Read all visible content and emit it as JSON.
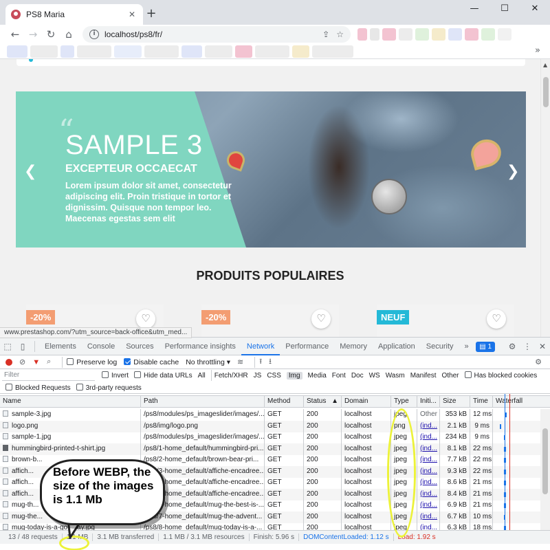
{
  "browser": {
    "tab_title": "PS8 Maria",
    "url": "localhost/ps8/fr/",
    "status_url": "www.prestashop.com/?utm_source=back-office&utm_med..."
  },
  "slider": {
    "title": "SAMPLE 3",
    "subtitle": "EXCEPTEUR OCCAECAT",
    "text": "Lorem ipsum dolor sit amet, consectetur adipiscing elit. Proin tristique in tortor et dignissim. Quisque non tempor leo. Maecenas egestas sem elit"
  },
  "section": {
    "title": "PRODUITS POPULAIRES"
  },
  "products": [
    {
      "badge": "-20%",
      "badge_type": "discount"
    },
    {
      "badge": "-20%",
      "badge_type": "discount"
    },
    {
      "badge": "NEUF",
      "badge_type": "new"
    }
  ],
  "devtools": {
    "tabs": [
      "Elements",
      "Console",
      "Sources",
      "Performance insights",
      "Network",
      "Performance",
      "Memory",
      "Application",
      "Security"
    ],
    "active_tab": "Network",
    "message_count": "1",
    "toolbar": {
      "preserve_log": "Preserve log",
      "disable_cache": "Disable cache",
      "throttling": "No throttling"
    },
    "filter": {
      "placeholder": "Filter",
      "invert": "Invert",
      "hide_data_urls": "Hide data URLs",
      "types": [
        "All",
        "Fetch/XHR",
        "JS",
        "CSS",
        "Img",
        "Media",
        "Font",
        "Doc",
        "WS",
        "Wasm",
        "Manifest",
        "Other"
      ],
      "active_type": "Img",
      "has_blocked_cookies": "Has blocked cookies",
      "blocked_requests": "Blocked Requests",
      "third_party": "3rd-party requests"
    },
    "columns": [
      "Name",
      "Path",
      "Method",
      "Status",
      "Domain",
      "Type",
      "Initi...",
      "Size",
      "Time",
      "Waterfall"
    ],
    "rows": [
      {
        "name": "sample-3.jpg",
        "path": "/ps8/modules/ps_imageslider/images/...",
        "method": "GET",
        "status": "200",
        "domain": "localhost",
        "type": "jpeg",
        "initiator": "Other",
        "size": "353 kB",
        "time": "12 ms"
      },
      {
        "name": "logo.png",
        "path": "/ps8/img/logo.png",
        "method": "GET",
        "status": "200",
        "domain": "localhost",
        "type": "png",
        "initiator": "(ind...",
        "size": "2.1 kB",
        "time": "9 ms"
      },
      {
        "name": "sample-1.jpg",
        "path": "/ps8/modules/ps_imageslider/images/...",
        "method": "GET",
        "status": "200",
        "domain": "localhost",
        "type": "jpeg",
        "initiator": "(ind...",
        "size": "234 kB",
        "time": "9 ms"
      },
      {
        "name": "hummingbird-printed-t-shirt.jpg",
        "path": "/ps8/1-home_default/hummingbird-pri...",
        "method": "GET",
        "status": "200",
        "domain": "localhost",
        "type": "jpeg",
        "initiator": "(ind...",
        "size": "8.1 kB",
        "time": "22 ms"
      },
      {
        "name": "brown-b...",
        "path": "/ps8/2-home_default/brown-bear-pri...",
        "method": "GET",
        "status": "200",
        "domain": "localhost",
        "type": "jpeg",
        "initiator": "(ind...",
        "size": "7.7 kB",
        "time": "22 ms"
      },
      {
        "name": "affich...",
        "path": "/ps8/3-home_default/affiche-encadree...",
        "method": "GET",
        "status": "200",
        "domain": "localhost",
        "type": "jpeg",
        "initiator": "(ind...",
        "size": "9.3 kB",
        "time": "22 ms"
      },
      {
        "name": "affich...",
        "path": "/ps8/4-home_default/affiche-encadree...",
        "method": "GET",
        "status": "200",
        "domain": "localhost",
        "type": "jpeg",
        "initiator": "(ind...",
        "size": "8.6 kB",
        "time": "21 ms"
      },
      {
        "name": "affich...",
        "path": "/ps8/5-home_default/affiche-encadree...",
        "method": "GET",
        "status": "200",
        "domain": "localhost",
        "type": "jpeg",
        "initiator": "(ind...",
        "size": "8.4 kB",
        "time": "21 ms"
      },
      {
        "name": "mug-th...",
        "path": "/ps8/6-home_default/mug-the-best-is-...",
        "method": "GET",
        "status": "200",
        "domain": "localhost",
        "type": "jpeg",
        "initiator": "(ind...",
        "size": "6.9 kB",
        "time": "21 ms"
      },
      {
        "name": "mug-the...",
        "path": "/ps8/7-home_default/mug-the-advent...",
        "method": "GET",
        "status": "200",
        "domain": "localhost",
        "type": "jpeg",
        "initiator": "(ind...",
        "size": "6.7 kB",
        "time": "10 ms"
      },
      {
        "name": "mug-today-is-a-go...day.jpg",
        "path": "/ps8/8-home_default/mug-today-is-a-...",
        "method": "GET",
        "status": "200",
        "domain": "localhost",
        "type": "jpeg",
        "initiator": "(ind...",
        "size": "6.3 kB",
        "time": "18 ms"
      }
    ],
    "summary": {
      "requests": "13 / 48 requests",
      "transferred_img": "1.1 MB",
      "transferred_total": "3.1 MB transferred",
      "resources": "1.1 MB / 3.1 MB resources",
      "finish": "Finish: 5.96 s",
      "dom_content_loaded": "DOMContentLoaded: 1.12 s",
      "load": "Load: 1.92 s"
    }
  },
  "annotation": {
    "callout_text": "Before WEBP, the size of the images is 1.1 Mb",
    "highlight_color": "#ecf23a"
  }
}
